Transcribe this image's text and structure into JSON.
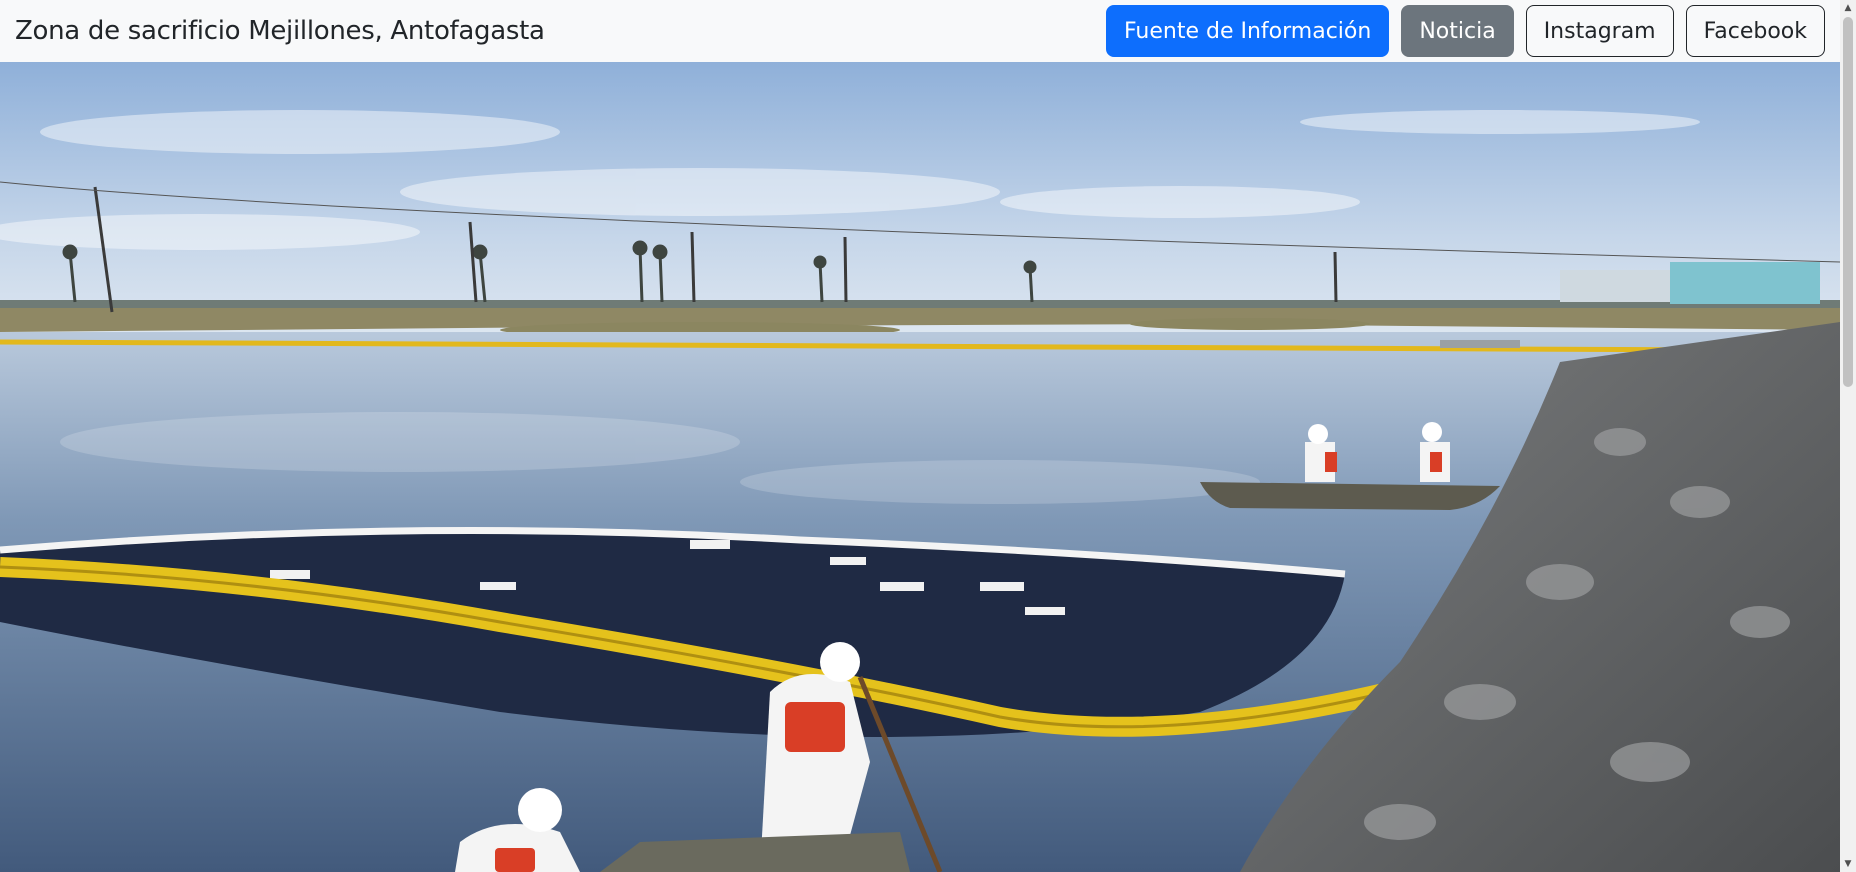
{
  "page": {
    "title": "Zona de sacrificio Mejillones, Antofagasta"
  },
  "nav": {
    "buttons": [
      {
        "label": "Fuente de Información",
        "style": "primary",
        "color": "#0d6efd"
      },
      {
        "label": "Noticia",
        "style": "secondary",
        "color": "#6c757d"
      },
      {
        "label": "Instagram",
        "style": "outline"
      },
      {
        "label": "Facebook",
        "style": "outline"
      }
    ]
  },
  "hero": {
    "subject": "oil spill cleanup crew in wetland water with containment booms"
  },
  "icons": {
    "scroll_up": "scroll-up-arrow-icon",
    "scroll_down": "scroll-down-arrow-icon"
  }
}
